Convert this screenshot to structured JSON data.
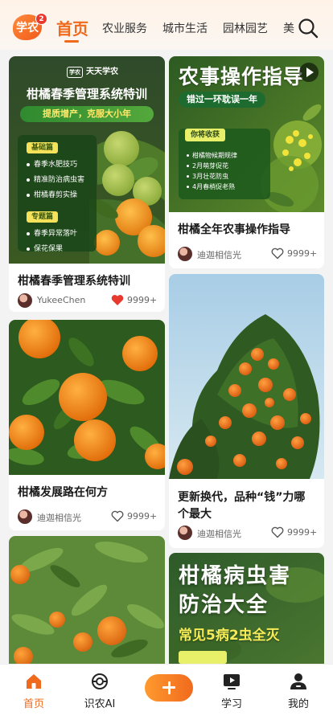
{
  "header": {
    "logo_text": "学农",
    "badge_count": "2",
    "tabs": [
      {
        "label": "首页",
        "active": true
      },
      {
        "label": "农业服务"
      },
      {
        "label": "城市生活"
      },
      {
        "label": "园林园艺"
      },
      {
        "label": "美"
      }
    ],
    "search_icon": "search-icon"
  },
  "feed": {
    "cards": [
      {
        "title": "柑橘春季管理系统特训",
        "author": "YukeeChen",
        "likes": "9999+",
        "liked": true,
        "poster": {
          "brand_box": "学农",
          "brand": "天天学农",
          "title": "柑橘春季管理系统特训",
          "slogan": "提质增产，克服大小年",
          "section1": "基础篇",
          "items1": [
            "春季水肥技巧",
            "精准防治病虫害",
            "柑橘春剪实操"
          ],
          "section2": "专题篇",
          "items2": [
            "春季异常落叶",
            "保花保果"
          ]
        }
      },
      {
        "title": "柑橘全年农事操作指导",
        "author": "迪迦相信光",
        "likes": "9999+",
        "liked": false,
        "poster": {
          "title": "农事操作指导",
          "slogan": "错过一环耽误一年",
          "box_tag": "你将收获",
          "items": [
            "柑橘物候期规律",
            "2月萌芽促花",
            "3月壮花防虫",
            "4月春梢促老熟"
          ]
        }
      },
      {
        "title": "柑橘发展路在何方",
        "author": "迪迦相信光",
        "likes": "9999+",
        "liked": false
      },
      {
        "title_line1": "更新换代，品种“钱”力哪",
        "title_line2": "个最大",
        "author": "迪迦相信光",
        "likes": "9999+",
        "liked": false
      },
      {
        "poster": {
          "line1": "柑橘病虫害",
          "line2": "防治大全",
          "sub": "常见5病2虫全灭"
        }
      }
    ]
  },
  "bottom_nav": {
    "items": [
      {
        "label": "首页",
        "icon": "home-icon",
        "active": true
      },
      {
        "label": "识农AI",
        "icon": "ai-scan-icon"
      },
      {
        "label": "",
        "icon": "plus-icon"
      },
      {
        "label": "学习",
        "icon": "play-video-icon"
      },
      {
        "label": "我的",
        "icon": "user-icon"
      }
    ]
  },
  "colors": {
    "accent": "#f06a1e",
    "like_red": "#e8392e",
    "poster_green": "#2f8a2f"
  }
}
